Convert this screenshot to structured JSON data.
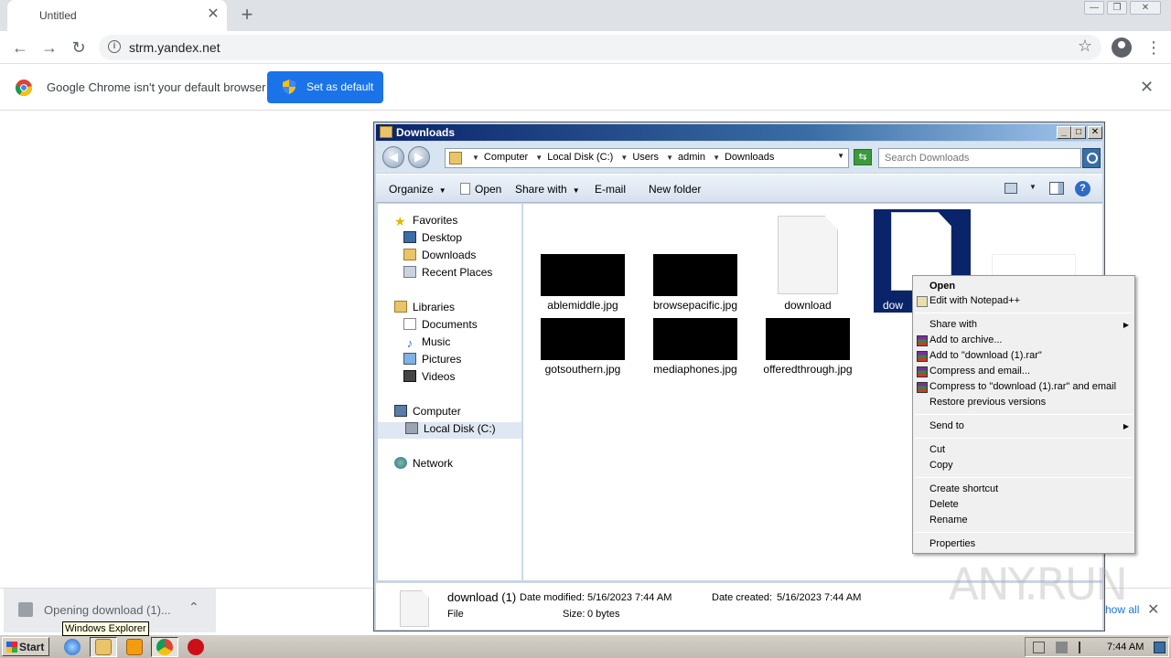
{
  "browser": {
    "tab_title": "Untitled",
    "tab_close": "✕",
    "new_tab": "+",
    "url": "strm.yandex.net",
    "window_controls": [
      "—",
      "❐",
      "✕"
    ]
  },
  "infobar": {
    "message": "Google Chrome isn't your default browser",
    "button_label": "Set as default",
    "close": "✕"
  },
  "downloads_shelf": {
    "item_text": "Opening download (1)...",
    "show_all": "Show all",
    "tooltip": "Windows Explorer"
  },
  "explorer": {
    "title": "Downloads",
    "breadcrumb": [
      "Computer",
      "Local Disk (C:)",
      "Users",
      "admin",
      "Downloads"
    ],
    "search_placeholder": "Search Downloads",
    "commands": {
      "organize": "Organize",
      "open": "Open",
      "share_with": "Share with",
      "email": "E-mail",
      "new_folder": "New folder"
    },
    "nav": {
      "favorites": "Favorites",
      "desktop": "Desktop",
      "downloads": "Downloads",
      "recent_places": "Recent Places",
      "libraries": "Libraries",
      "documents": "Documents",
      "music": "Music",
      "pictures": "Pictures",
      "videos": "Videos",
      "computer": "Computer",
      "local_disk": "Local Disk (C:)",
      "network": "Network"
    },
    "files": {
      "ablemiddle": "ablemiddle.jpg",
      "browsepacific": "browsepacific.jpg",
      "download": "download",
      "download1_partial": "dow",
      "gotsouthern": "gotsouthern.jpg",
      "mediaphones": "mediaphones.jpg",
      "offeredthrough": "offeredthrough.jpg"
    },
    "details": {
      "name": "download (1)",
      "type": "File",
      "date_modified_label": "Date modified:",
      "date_modified": "5/16/2023 7:44 AM",
      "date_created_label": "Date created:",
      "date_created": "5/16/2023 7:44 AM",
      "size_label": "Size:",
      "size": "0 bytes"
    }
  },
  "context_menu": {
    "open": "Open",
    "edit_notepad": "Edit with Notepad++",
    "share_with": "Share with",
    "add_archive": "Add to archive...",
    "add_rar": "Add to \"download (1).rar\"",
    "compress_email": "Compress and email...",
    "compress_rar_email": "Compress to \"download (1).rar\" and email",
    "restore": "Restore previous versions",
    "send_to": "Send to",
    "cut": "Cut",
    "copy": "Copy",
    "create_shortcut": "Create shortcut",
    "delete": "Delete",
    "rename": "Rename",
    "properties": "Properties"
  },
  "watermark": "ANY.RUN",
  "taskbar": {
    "start": "Start",
    "clock": "7:44 AM"
  },
  "colors": {
    "chrome_blue": "#1a73e8",
    "xp_title": "#0a246a",
    "selection": "#0a246a"
  }
}
